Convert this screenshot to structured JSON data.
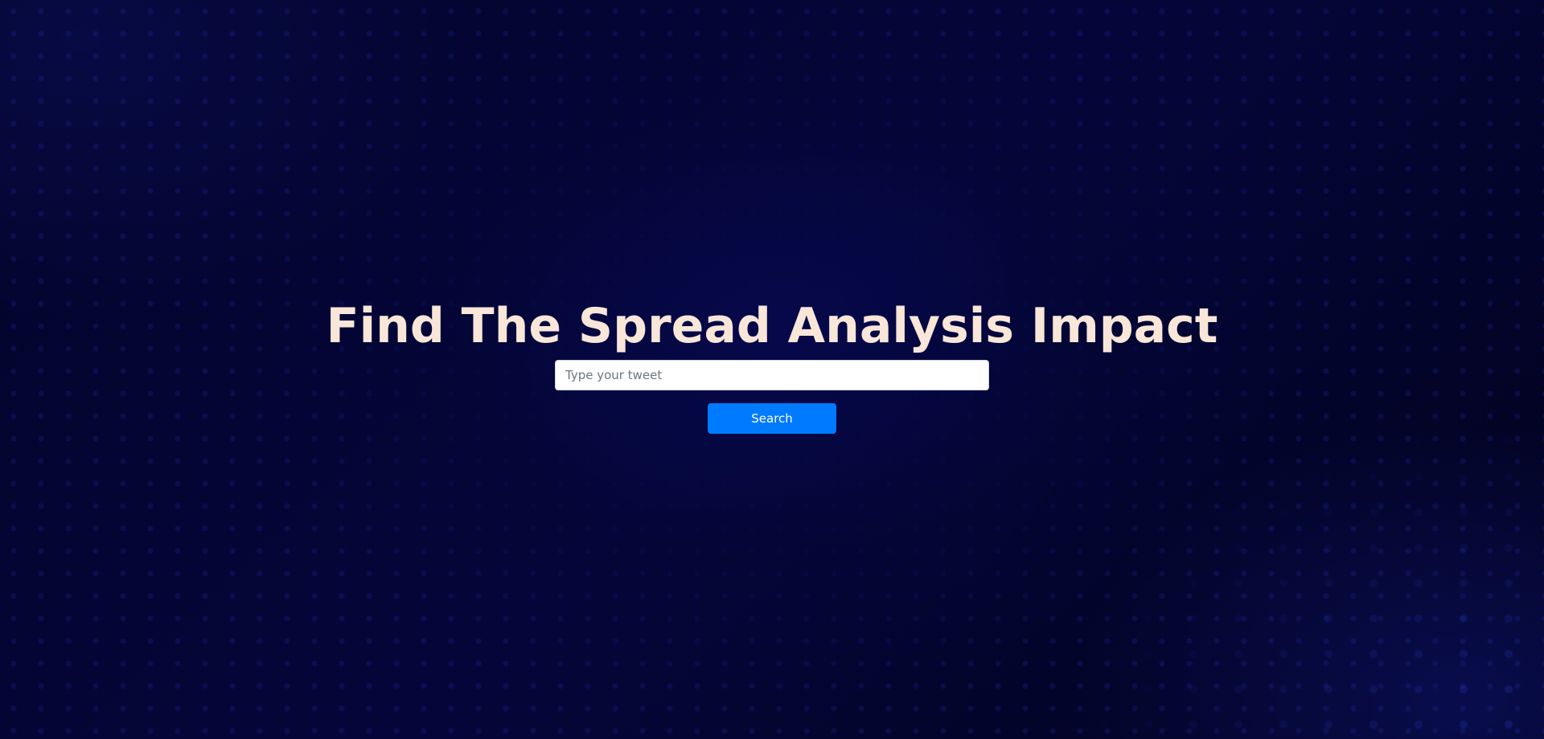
{
  "hero": {
    "title": "Find The Spread Analysis Impact"
  },
  "search": {
    "placeholder": "Type your tweet",
    "value": "",
    "button_label": "Search"
  },
  "colors": {
    "background": "#02031f",
    "title_text": "#f8e6d8",
    "button_background": "#007bff",
    "button_text": "#ffffff",
    "input_background": "#ffffff"
  }
}
